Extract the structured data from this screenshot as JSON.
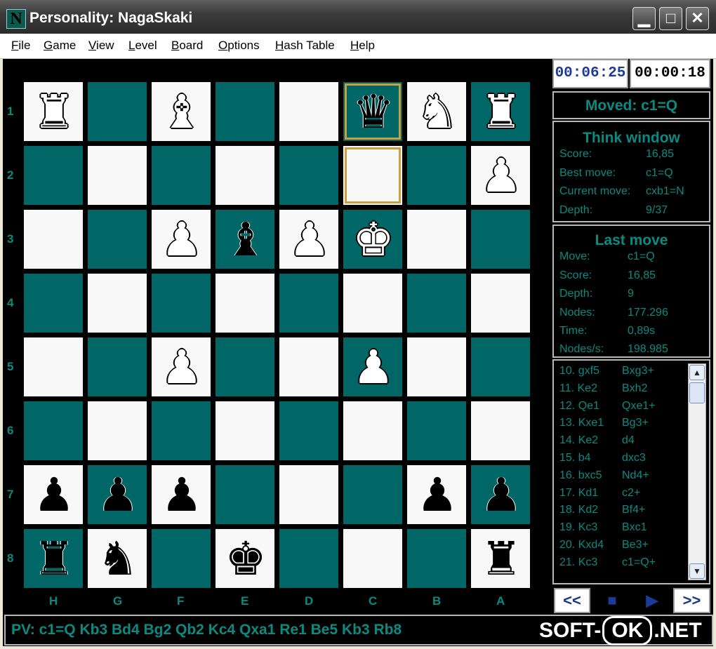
{
  "window": {
    "title": "Personality: NagaSkaki",
    "icon_letter": "N",
    "minimize_glyph": "▁",
    "maximize_glyph": "□",
    "close_glyph": "✕"
  },
  "menu": [
    "File",
    "Game",
    "View",
    "Level",
    "Board",
    "Options",
    "Hash Table",
    "Help"
  ],
  "board": {
    "ranks": [
      "1",
      "2",
      "3",
      "4",
      "5",
      "6",
      "7",
      "8"
    ],
    "files": [
      "H",
      "G",
      "F",
      "E",
      "D",
      "C",
      "B",
      "A"
    ],
    "pieces": [
      {
        "square": "H1",
        "piece": "rook",
        "color": "white",
        "glyph": "♜"
      },
      {
        "square": "F1",
        "piece": "bishop",
        "color": "white",
        "glyph": "♝"
      },
      {
        "square": "C1",
        "piece": "queen",
        "color": "black",
        "glyph": "♛"
      },
      {
        "square": "B1",
        "piece": "knight",
        "color": "white",
        "glyph": "♞"
      },
      {
        "square": "A1",
        "piece": "rook",
        "color": "white",
        "glyph": "♜"
      },
      {
        "square": "A2",
        "piece": "pawn",
        "color": "white",
        "glyph": "♟"
      },
      {
        "square": "F3",
        "piece": "pawn",
        "color": "white",
        "glyph": "♟"
      },
      {
        "square": "E3",
        "piece": "bishop",
        "color": "black",
        "glyph": "♝"
      },
      {
        "square": "D3",
        "piece": "pawn",
        "color": "white",
        "glyph": "♟"
      },
      {
        "square": "C3",
        "piece": "king",
        "color": "white",
        "glyph": "♚"
      },
      {
        "square": "F5",
        "piece": "pawn",
        "color": "white",
        "glyph": "♟"
      },
      {
        "square": "C5",
        "piece": "pawn",
        "color": "white",
        "glyph": "♟"
      },
      {
        "square": "H7",
        "piece": "pawn",
        "color": "black",
        "glyph": "♟"
      },
      {
        "square": "G7",
        "piece": "pawn",
        "color": "black",
        "glyph": "♟"
      },
      {
        "square": "F7",
        "piece": "pawn",
        "color": "black",
        "glyph": "♟"
      },
      {
        "square": "B7",
        "piece": "pawn",
        "color": "black",
        "glyph": "♟"
      },
      {
        "square": "A7",
        "piece": "pawn",
        "color": "black",
        "glyph": "♟"
      },
      {
        "square": "H8",
        "piece": "rook",
        "color": "black",
        "glyph": "♜"
      },
      {
        "square": "G8",
        "piece": "knight",
        "color": "black",
        "glyph": "♞"
      },
      {
        "square": "E8",
        "piece": "king",
        "color": "black",
        "glyph": "♚"
      },
      {
        "square": "A8",
        "piece": "rook",
        "color": "black",
        "glyph": "♜"
      }
    ],
    "highlighted_squares": [
      "C1",
      "C2"
    ],
    "colors": {
      "light": "#f8f8f8",
      "dark": "#006666",
      "highlight": "#c8a040"
    }
  },
  "clocks": {
    "white": "00:06:25",
    "black": "00:00:18"
  },
  "moved": "Moved: c1=Q",
  "think": {
    "title": "Think window",
    "rows": [
      {
        "label": "Score:",
        "value": "16,85"
      },
      {
        "label": "Best move:",
        "value": "c1=Q"
      },
      {
        "label": "Current move:",
        "value": "cxb1=N"
      },
      {
        "label": "Depth:",
        "value": "9/37"
      }
    ]
  },
  "last_move": {
    "title": "Last move",
    "rows": [
      {
        "label": "Move:",
        "value": "c1=Q"
      },
      {
        "label": "Score:",
        "value": "16,85"
      },
      {
        "label": "Depth:",
        "value": "9"
      },
      {
        "label": "Nodes:",
        "value": "177.296"
      },
      {
        "label": "Time:",
        "value": "0,89s"
      },
      {
        "label": "Nodes/s:",
        "value": "198.985"
      }
    ]
  },
  "move_list": [
    {
      "white": "10. gxf5",
      "black": "Bxg3+"
    },
    {
      "white": "11. Ke2",
      "black": "Bxh2"
    },
    {
      "white": "12. Qe1",
      "black": "Qxe1+"
    },
    {
      "white": "13. Kxe1",
      "black": "Bg3+"
    },
    {
      "white": "14. Ke2",
      "black": "d4"
    },
    {
      "white": "15. b4",
      "black": "dxc3"
    },
    {
      "white": "16. bxc5",
      "black": "Nd4+"
    },
    {
      "white": "17. Kd1",
      "black": "c2+"
    },
    {
      "white": "18. Kd2",
      "black": "Bf4+"
    },
    {
      "white": "19. Kc3",
      "black": "Bxc1"
    },
    {
      "white": "20. Kxd4",
      "black": "Be3+"
    },
    {
      "white": "21. Kc3",
      "black": "c1=Q+"
    }
  ],
  "scroll": {
    "up_glyph": "▲",
    "down_glyph": "▼"
  },
  "controls": {
    "first": "<<",
    "stop": "■",
    "play": "▶",
    "next": ">>"
  },
  "pv": "PV: c1=Q Kb3 Bd4 Bg2 Qb2 Kc4 Qxa1 Re1 Be5 Kb3 Rb8",
  "watermark": {
    "left": "SOFT-",
    "middle": "OK",
    "right": ".NET"
  }
}
